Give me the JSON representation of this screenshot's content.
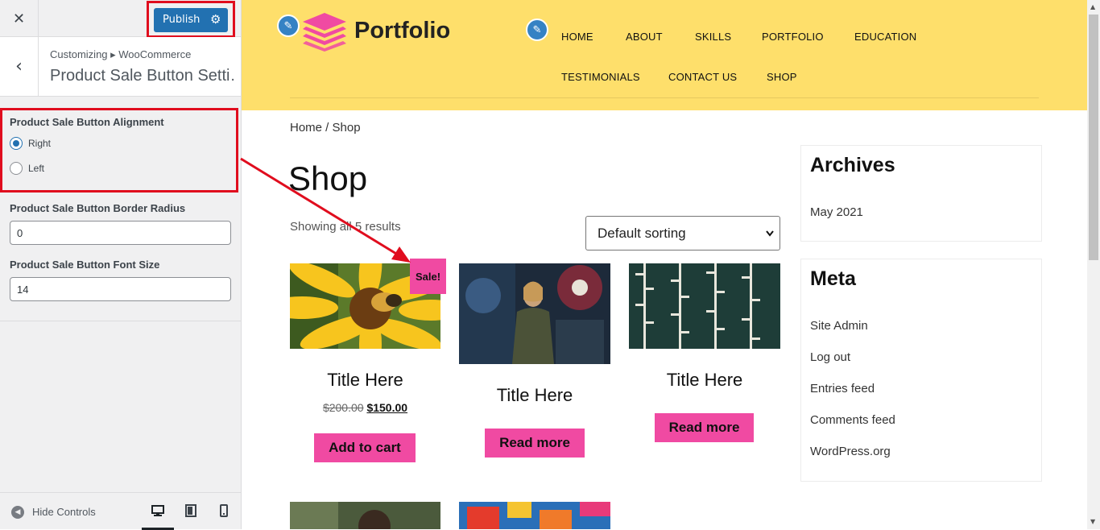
{
  "customizer": {
    "close_icon": "close-icon",
    "publish_label": "Publish",
    "settings_icon": "gear-icon",
    "back_icon": "chevron-left-icon",
    "breadcrumb": "Customizing ▸ WooCommerce",
    "section_title": "Product Sale Button Setti…",
    "alignment": {
      "label": "Product Sale Button Alignment",
      "options": [
        {
          "label": "Right",
          "selected": true
        },
        {
          "label": "Left",
          "selected": false
        }
      ]
    },
    "border_radius": {
      "label": "Product Sale Button Border Radius",
      "value": "0"
    },
    "font_size": {
      "label": "Product Sale Button Font Size",
      "value": "14"
    },
    "footer": {
      "hide_controls": "Hide Controls",
      "devices": [
        "desktop-icon",
        "tablet-icon",
        "mobile-icon"
      ],
      "active_device": "desktop"
    },
    "highlight_color": "#e00d1e",
    "accent_color": "#2271b1"
  },
  "preview": {
    "site_title": "Portfolio",
    "header_bg": "#fedf6b",
    "accent_pink": "#f04aa2",
    "nav_row1": [
      "HOME",
      "ABOUT",
      "SKILLS",
      "PORTFOLIO",
      "EDUCATION"
    ],
    "nav_row2": [
      "TESTIMONIALS",
      "CONTACT US",
      "SHOP"
    ],
    "breadcrumb": "Home / Shop",
    "page_title": "Shop",
    "results": "Showing all 5 results",
    "sorting": "Default sorting",
    "sale_badge": "Sale!",
    "products": [
      {
        "title": "Title Here",
        "old_price": "$200.00",
        "price": "$150.00",
        "button": "Add to cart",
        "on_sale": true
      },
      {
        "title": "Title Here",
        "button": "Read more",
        "on_sale": false
      },
      {
        "title": "Title Here",
        "button": "Read more",
        "on_sale": false
      }
    ],
    "widgets": {
      "archives": {
        "title": "Archives",
        "items": [
          "May 2021"
        ]
      },
      "meta": {
        "title": "Meta",
        "items": [
          "Site Admin",
          "Log out",
          "Entries feed",
          "Comments feed",
          "WordPress.org"
        ]
      }
    }
  }
}
